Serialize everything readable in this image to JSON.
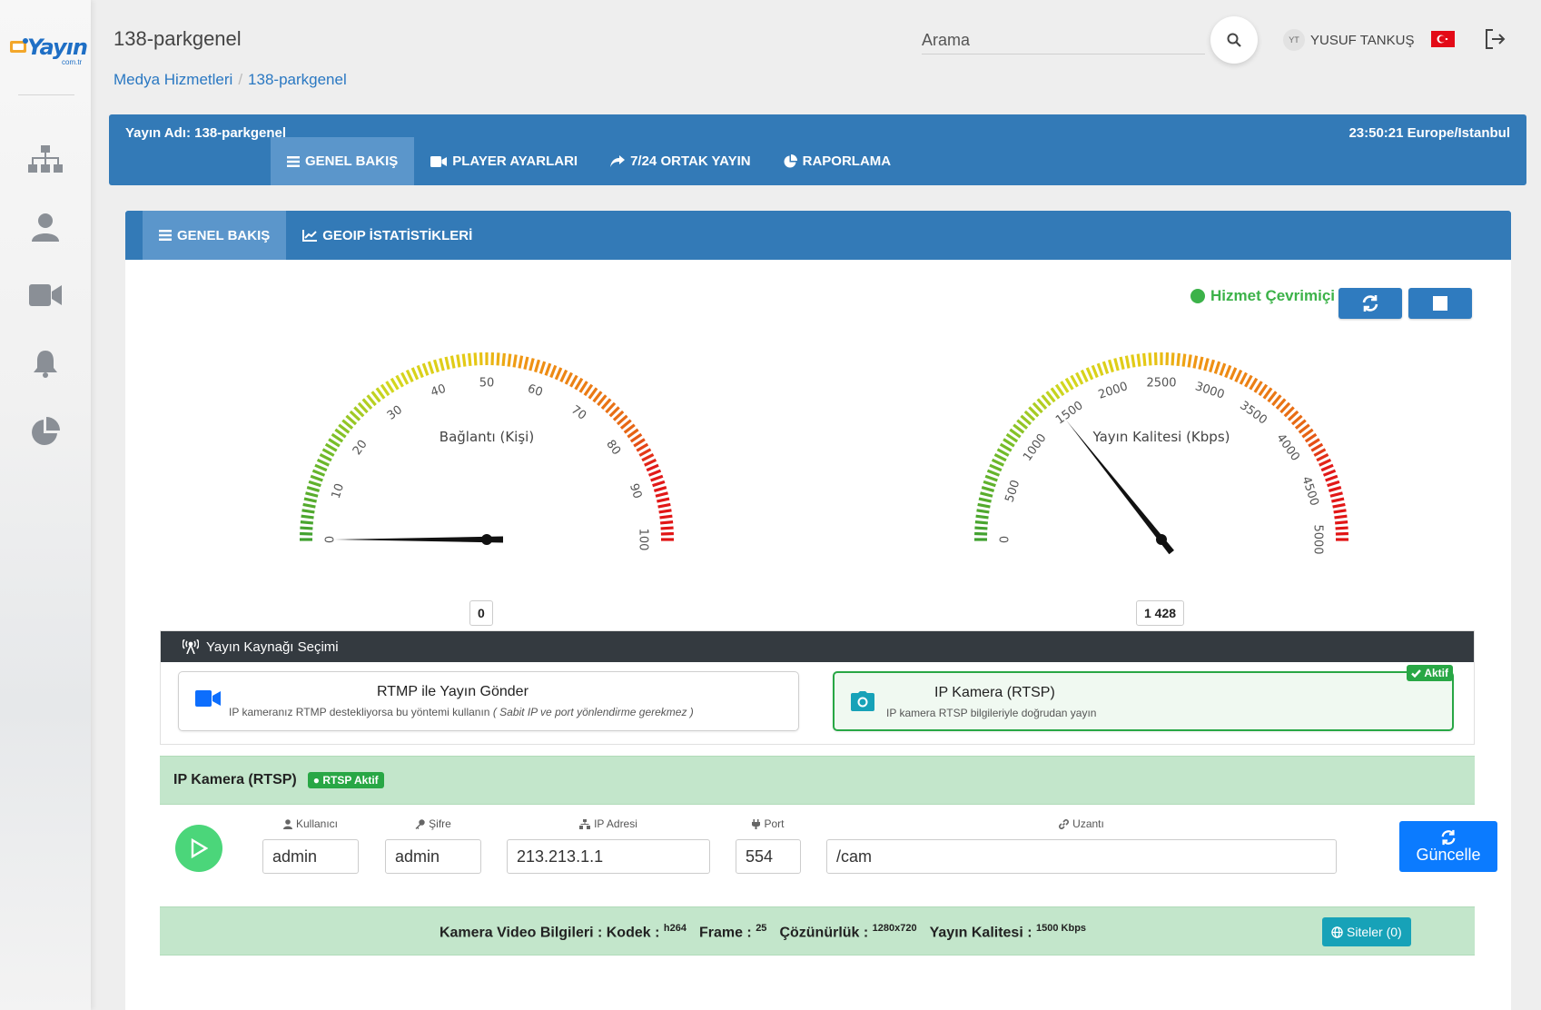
{
  "brand": {
    "logo_text": "Yayın",
    "logo_sub": "com.tr"
  },
  "header": {
    "title": "138-parkgenel",
    "breadcrumb": [
      "Medya Hizmetleri",
      "138-parkgenel"
    ],
    "search_placeholder": "Arama",
    "user_initials": "YT",
    "user_name": "YUSUF TANKUŞ"
  },
  "sidebar": {
    "icons": [
      "sitemap-icon",
      "user-icon",
      "video-icon",
      "bell-icon",
      "pie-chart-icon"
    ]
  },
  "service_bar": {
    "name": "Yayın Adı: 138-parkgenel",
    "time": "23:50:21 Europe/Istanbul",
    "tabs": [
      "GENEL BAKIŞ",
      "PLAYER AYARLARI",
      "7/24 ORTAK YAYIN",
      "RAPORLAMA"
    ],
    "active_tab": 0
  },
  "sub_tabs": {
    "tabs": [
      "GENEL BAKIŞ",
      "GEOIP İSTATİSTİKLERİ"
    ],
    "active_tab": 0
  },
  "status": {
    "label": "Hizmet Çevrimiçi",
    "color": "#3cb249"
  },
  "gauges": [
    {
      "title": "Bağlantı (Kişi)",
      "min": 0,
      "max": 100,
      "value": 0,
      "value_display": "0",
      "ticks": [
        "0",
        "10",
        "20",
        "30",
        "40",
        "50",
        "60",
        "70",
        "80",
        "90",
        "100"
      ]
    },
    {
      "title": "Yayın Kalitesi (Kbps)",
      "min": 0,
      "max": 5000,
      "value": 1428,
      "value_display": "1 428",
      "ticks": [
        "0",
        "500",
        "1000",
        "1500",
        "2000",
        "2500",
        "3000",
        "3500",
        "4000",
        "4500",
        "5000"
      ]
    }
  ],
  "source": {
    "heading": "Yayın Kaynağı Seçimi",
    "options": [
      {
        "title": "RTMP ile Yayın Gönder",
        "desc": "IP kameranız RTMP destekliyorsa bu yöntemi kullanın",
        "note": "( Sabit IP ve port yönlendirme gerekmez )"
      },
      {
        "title": "IP Kamera (RTSP)",
        "desc": "IP kamera RTSP bilgileriyle doğrudan yayın",
        "badge": "Aktif"
      }
    ],
    "active": 1
  },
  "rtsp": {
    "title": "IP Kamera (RTSP)",
    "badge": "● RTSP Aktif",
    "labels": {
      "user": "Kullanıcı",
      "password": "Şifre",
      "ip": "IP Adresi",
      "port": "Port",
      "path": "Uzantı"
    },
    "values": {
      "user": "admin",
      "password": "admin",
      "ip": "213.213.1.1",
      "port": "554",
      "path": "/cam"
    },
    "update_label": "Güncelle"
  },
  "camera_info": {
    "prefix": "Kamera Video Bilgileri : Kodek :",
    "codec": "h264",
    "frame_label": "Frame :",
    "frame": "25",
    "res_label": "Çözünürlük :",
    "resolution": "1280x720",
    "quality_label": "Yayın Kalitesi :",
    "quality": "1500 Kbps",
    "sites_label": "Siteler (0)"
  }
}
